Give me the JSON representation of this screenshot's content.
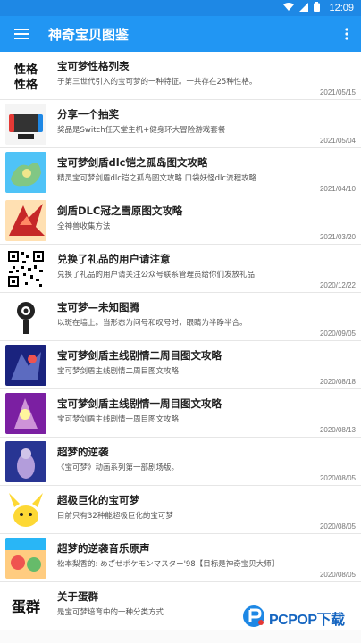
{
  "status": {
    "time": "12:09"
  },
  "appbar": {
    "title": "神奇宝贝图鉴"
  },
  "items": [
    {
      "title": "宝可梦性格列表",
      "desc": "于第三世代引入的宝可梦的一种特征。一共存在25种性格。",
      "date": "2021/05/15",
      "thumb_text": "性格性格"
    },
    {
      "title": "分享一个抽奖",
      "desc": "奖品是Switch任天堂主机+健身环大冒险游戏套餐",
      "date": "2021/05/04"
    },
    {
      "title": "宝可梦剑盾dlc铠之孤岛图文攻略",
      "desc": "精灵宝可梦剑盾dlc铠之孤岛图文攻略 口袋妖怪dlc流程攻略",
      "date": "2021/04/10"
    },
    {
      "title": "剑盾DLC冠之雪原图文攻略",
      "desc": "全神兽收集方法",
      "date": "2021/03/20"
    },
    {
      "title": "兑换了礼品的用户请注意",
      "desc": "兑换了礼品的用户请关注公众号联系管理员给你们发放礼品",
      "date": "2020/12/22"
    },
    {
      "title": "宝可梦—未知图腾",
      "desc": "以斑在墙上。当形态为问号和叹号时，眼睛为半睁半合。",
      "date": "2020/09/05"
    },
    {
      "title": "宝可梦剑盾主线剧情二周目图文攻略",
      "desc": "宝可梦剑盾主线剧情二周目图文攻略",
      "date": "2020/08/18"
    },
    {
      "title": "宝可梦剑盾主线剧情一周目图文攻略",
      "desc": "宝可梦剑盾主线剧情一周目图文攻略",
      "date": "2020/08/13"
    },
    {
      "title": "超梦的逆袭",
      "desc": "《宝可梦》动画系列第一部剧场版。",
      "date": "2020/08/05"
    },
    {
      "title": "超极巨化的宝可梦",
      "desc": "目前只有32种能超极巨化的宝可梦",
      "date": "2020/08/05"
    },
    {
      "title": "超梦的逆袭音乐原声",
      "desc": "松本梨香的: めざせポケモンマスター'98【目标是神奇宝贝大师】",
      "date": "2020/08/05"
    },
    {
      "title": "关于蛋群",
      "desc": "是宝可梦培育中的一种分类方式",
      "date": "",
      "thumb_text": "蛋群"
    }
  ],
  "watermark": {
    "text": "PCPOP下载"
  },
  "colors": {
    "appbar": "#2196f3",
    "statusbar": "#1e88e5"
  },
  "icons": [
    "menu-icon",
    "more-vert-icon",
    "wifi-icon",
    "signal-icon",
    "battery-icon"
  ]
}
